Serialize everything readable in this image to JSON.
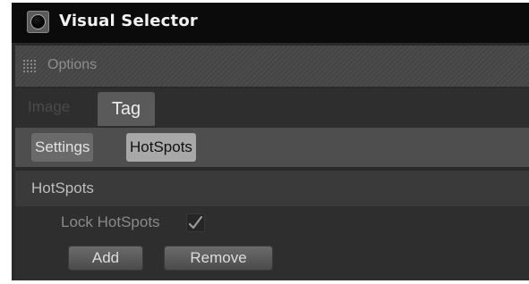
{
  "window": {
    "title": "Visual Selector",
    "icon": "visual-selector-app-icon"
  },
  "menubar": {
    "grip_icon": "grip-dots-icon",
    "options_label": "Options"
  },
  "tabs": [
    {
      "label": "Image",
      "active": false
    },
    {
      "label": "Tag",
      "active": true
    }
  ],
  "subtabs": [
    {
      "label": "Settings",
      "active": false
    },
    {
      "label": "HotSpots",
      "active": true
    }
  ],
  "section": {
    "title": "HotSpots",
    "lock_label": "Lock HotSpots",
    "lock_checked": true,
    "add_label": "Add",
    "remove_label": "Remove"
  },
  "colors": {
    "title_bar": "#0b0b0b",
    "panel_bg": "#2a2a2a",
    "active_subtab": "#a8a8a8",
    "active_tab": "#5a5a5a"
  }
}
